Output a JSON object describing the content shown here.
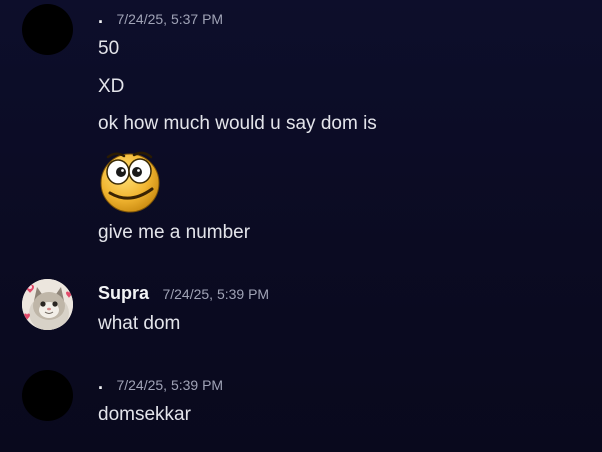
{
  "messages": [
    {
      "username": ".",
      "timestamp": "7/24/25, 5:37 PM",
      "lines": [
        "50",
        "XD",
        "ok how much would u say dom is"
      ],
      "emoji": "googly-eyed-smiley-emoji",
      "after_emoji": "give me a number"
    },
    {
      "username": "Supra",
      "timestamp": "7/24/25, 5:39 PM",
      "lines": [
        "what dom"
      ]
    },
    {
      "username": ".",
      "timestamp": "7/24/25, 5:39 PM",
      "lines": [
        "domsekkar"
      ]
    }
  ],
  "colors": {
    "background": "#0b0c24",
    "username": "#f2f3f5",
    "timestamp": "#a0a3b6",
    "text": "#e3e4ea"
  }
}
